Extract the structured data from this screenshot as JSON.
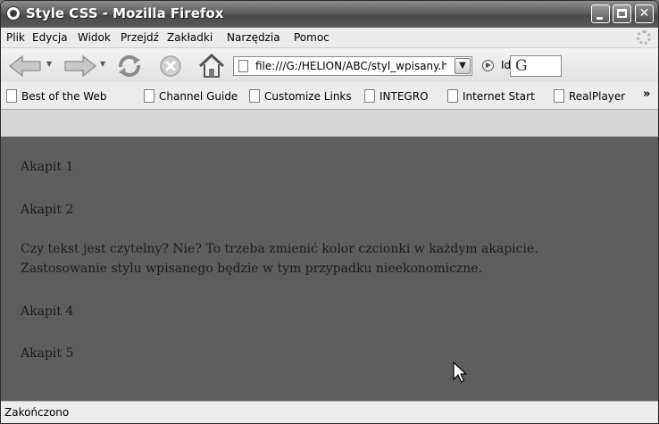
{
  "window": {
    "title": "Style CSS - Mozilla Firefox",
    "min_button": "minimize",
    "max_button": "maximize",
    "close_button": "✕"
  },
  "menu": [
    "Plik",
    "Edycja",
    "Widok",
    "Przejdź",
    "Zakładki",
    "Narzędzia",
    "Pomoc"
  ],
  "toolbar": {
    "url": "file:///G:/HELION/ABC/styl_wpisany.htm",
    "go_label": "Idź",
    "search_engine_glyph": "G",
    "icons": [
      "back-arrow-icon",
      "forward-arrow-icon",
      "reload-icon",
      "stop-icon",
      "home-icon",
      "page-icon",
      "go-icon"
    ]
  },
  "bookmarks": [
    "Best of the Web",
    "Channel Guide",
    "Customize Links",
    "INTEGRO",
    "Internet Start",
    "RealPlayer"
  ],
  "bookmarks_more": "»",
  "content": {
    "p1": "Akapit 1",
    "p2": "Akapit 2",
    "p3_line1": "Czy tekst jest czytelny? Nie? To trzeba zmienić kolor czcionki w każdym akapicie.",
    "p3_line2": "Zastosowanie stylu wpisanego będzie w tym przypadku nieekonomiczne.",
    "p4": "Akapit 4",
    "p5": "Akapit 5"
  },
  "status": "Zakończono",
  "colors": {
    "content_background": "#5e5e5e",
    "text": "#1c1c1c"
  }
}
